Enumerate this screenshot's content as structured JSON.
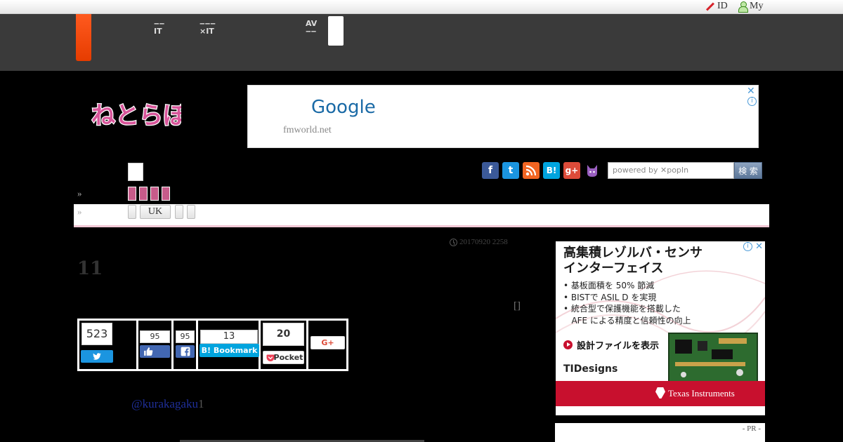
{
  "topbar": {
    "id_label": "ID",
    "my_label": "My"
  },
  "network": {
    "links": [
      {
        "line1": "‒‒",
        "line2": "IT"
      },
      {
        "line1": "‒‒‒",
        "line2": "×IT"
      },
      {
        "line1": "AV",
        "line2": "‒‒"
      }
    ]
  },
  "logo": {
    "text": "ねとらぼ"
  },
  "ad_top": {
    "headline": "Google",
    "url": "fmworld.net",
    "close": "✕",
    "info": "i"
  },
  "nav": {
    "raquo": "»",
    "sub_raquo": "»",
    "sub_buttons": [
      "",
      "UK",
      "",
      ""
    ]
  },
  "social": {
    "icons": [
      "facebook-icon",
      "twitter-icon",
      "rss-icon",
      "hatena-icon",
      "googleplus-icon",
      "cat-icon"
    ],
    "labels": [
      "f",
      "t",
      "",
      "B!",
      "g+",
      ""
    ]
  },
  "search": {
    "placeholder": "powered by ✕popIn",
    "button": "検 索"
  },
  "article": {
    "date": "20170920 2258",
    "title": "11",
    "bracket": "[]",
    "handle": "@kurakagaku",
    "handle_suffix": "1"
  },
  "share": {
    "twitter_count": "523",
    "like_count": "95",
    "fb_share_count": "95",
    "hatena_count": "13",
    "hatena_label": "B! Bookmark",
    "pocket_count": "20",
    "pocket_label": "Pocket",
    "gplus_label": "G+"
  },
  "ad_right": {
    "headline_1": "高集積レゾルバ・センサ",
    "headline_2": "インターフェイス",
    "bullets": [
      "• 基板面積を 50% 節減",
      "• BISTで ASIL D を実現",
      "• 統合型で保護機能を搭載した",
      "   AFE による精度と信頼性の向上"
    ],
    "cta": "設計ファイルを表示",
    "tidesigns": "TIDesigns",
    "ti_brand": "Texas Instruments",
    "info": "i",
    "close": "✕"
  },
  "pr": {
    "label": "- PR -"
  },
  "colors": {
    "background": "#000000",
    "netbar": "#3a3a3a",
    "orange_tab": "#ff5a1f",
    "logo_pink": "#d8559a",
    "ti_red": "#c8102e",
    "twitter": "#1b95e0",
    "facebook": "#3b5998",
    "hatena": "#00a4de",
    "pocket": "#ee4056"
  }
}
